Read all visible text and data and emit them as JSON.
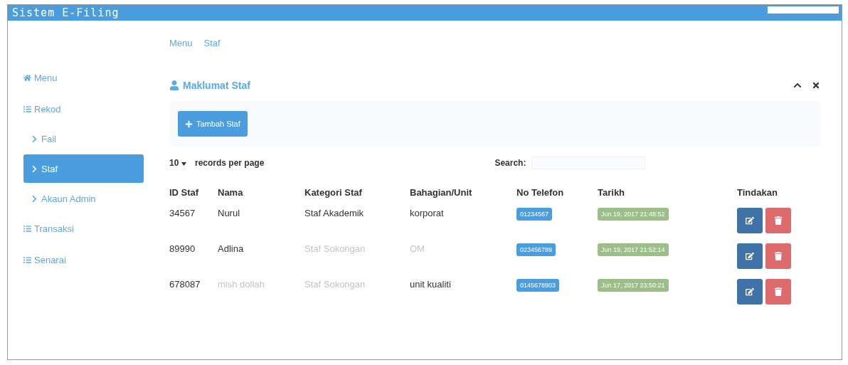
{
  "window": {
    "title": "Sistem E-Filing"
  },
  "sidebar": {
    "items": [
      {
        "kind": "home",
        "label": "Menu",
        "selected": false
      },
      {
        "kind": "top",
        "label": "Rekod",
        "selected": false
      },
      {
        "kind": "sub",
        "label": "Fail",
        "selected": false
      },
      {
        "kind": "sub",
        "label": "Staf",
        "selected": true
      },
      {
        "kind": "sub",
        "label": "Akaun Admin",
        "selected": false
      },
      {
        "kind": "top",
        "label": "Transaksi",
        "selected": false
      },
      {
        "kind": "top",
        "label": "Senarai",
        "selected": false
      }
    ]
  },
  "breadcrumb": [
    "Menu",
    "Staf"
  ],
  "panel": {
    "title": "Maklumat Staf",
    "add_button": "Tambah Staf",
    "page_size": "10",
    "page_size_label": "records per page",
    "search_label": "Search:",
    "table": {
      "columns": [
        "ID Staf",
        "Nama",
        "Kategori Staf",
        "Bahagian/Unit",
        "No Telefon",
        "Tarikh",
        "Tindakan"
      ],
      "rows": [
        {
          "id": {
            "text": "34567",
            "faded": false
          },
          "nama": {
            "text": "Nurul",
            "faded": false
          },
          "kategori": {
            "text": "Staf Akademik",
            "faded": false
          },
          "unit": {
            "text": "korporat",
            "faded": false
          },
          "telefon": "01234567",
          "tarikh": "Jun 19, 2017 21:48:52"
        },
        {
          "id": {
            "text": "89990",
            "faded": false
          },
          "nama": {
            "text": "Adlina",
            "faded": false
          },
          "kategori": {
            "text": "Staf Sokongan",
            "faded": true
          },
          "unit": {
            "text": "OM",
            "faded": true
          },
          "telefon": "023456789",
          "tarikh": "Jun 19, 2017 21:52:14"
        },
        {
          "id": {
            "text": "678087",
            "faded": false
          },
          "nama": {
            "text": "mish dollah",
            "faded": true
          },
          "kategori": {
            "text": "Staf Sokongan",
            "faded": true
          },
          "unit": {
            "text": "unit kualiti",
            "faded": false
          },
          "telefon": "0145678903",
          "tarikh": "Jun 17, 2017 23:50:21"
        }
      ]
    }
  }
}
